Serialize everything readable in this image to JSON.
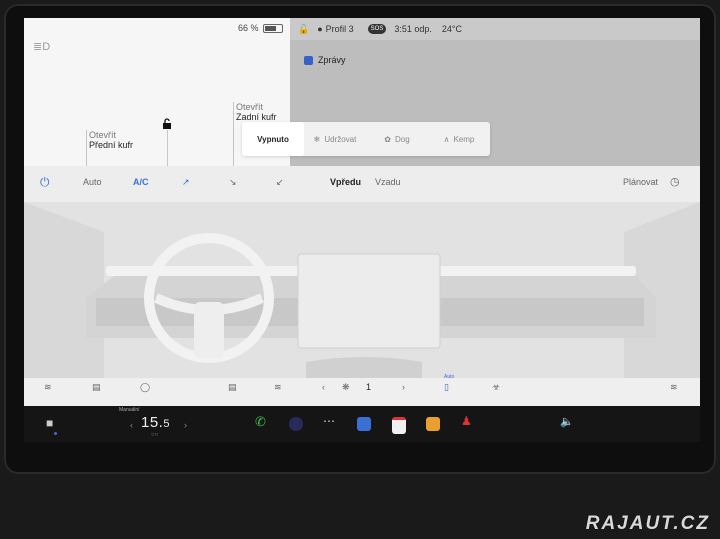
{
  "status": {
    "battery_percent": "66 %",
    "battery_level": 0.66,
    "profile": "Profil 3",
    "sos": "SOS",
    "time": "3:51 odp.",
    "outside_temp": "24°C"
  },
  "car": {
    "frunk_action": "Otevřít",
    "frunk_label": "Přední kufr",
    "trunk_action": "Otevřít",
    "trunk_label": "Zadní kufr"
  },
  "apps_panel": {
    "messages_label": "Zprávy"
  },
  "climate_mode": {
    "options": [
      "Vypnuto",
      "Udržovat",
      "Dog",
      "Kemp"
    ],
    "active": "Vypnuto"
  },
  "climate": {
    "auto_label": "Auto",
    "ac_label": "A/C",
    "front_label": "Vpředu",
    "rear_label": "Vzadu",
    "schedule_label": "Plánovat",
    "fan_speed": "1",
    "auto_small": "Auto"
  },
  "dock": {
    "temp_caption": "Manuální",
    "temp_whole": "15.",
    "temp_fraction": "5"
  },
  "watermark": "RAJAUT.CZ",
  "colors": {
    "accent": "#3a6fd6",
    "status_bar": "#c9c9c9",
    "panel_grey": "#bdbdbd"
  }
}
